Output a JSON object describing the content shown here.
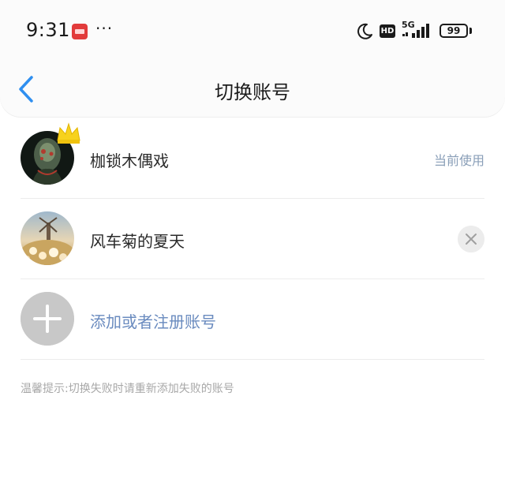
{
  "status_bar": {
    "time": "9:31",
    "more": "···",
    "hd_label": "HD",
    "network": "5G",
    "battery": "99"
  },
  "header": {
    "title": "切换账号"
  },
  "accounts": [
    {
      "name": "枷锁木偶戏",
      "status": "当前使用"
    },
    {
      "name": "风车菊的夏天"
    }
  ],
  "add_account": {
    "label": "添加或者注册账号"
  },
  "hint": "温馨提示:切换失败时请重新添加失败的账号",
  "colors": {
    "accent": "#2f8ff0",
    "link": "#6a8bbf",
    "current_tag": "#8a9fb8"
  }
}
